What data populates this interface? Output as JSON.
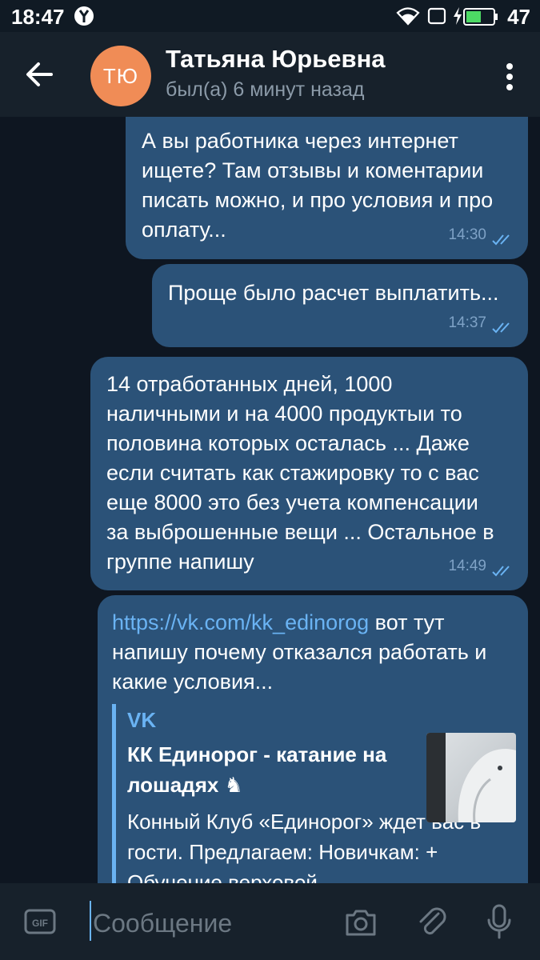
{
  "status_bar": {
    "time": "18:47",
    "battery_percent": "47"
  },
  "header": {
    "avatar_initials": "ТЮ",
    "name": "Татьяна Юрьевна",
    "status": "был(а) 6 минут назад"
  },
  "messages": [
    {
      "text": "А вы работника через интернет\nищете? Там отзывы и коментарии\nписать можно, и про условия и про\nоплату...",
      "time": "14:30"
    },
    {
      "text": "Проще было расчет выплатить...",
      "time": "14:37"
    },
    {
      "text": "14 отработанных дней, 1000\nналичными и на 4000 продуктыи то\nполовина которых осталась ... Даже\nесли считать как стажировку то с вас\nеще 8000 это без учета компенсации\nза выброшенные вещи ... Остальное в\nгруппе напишу",
      "time": "14:49"
    },
    {
      "link": "https://vk.com/kk_edinorog",
      "text": " вот тут\nнапишу почему отказался работать и\nкакие условия...",
      "preview": {
        "site": "VK",
        "title": "КК Единорог - катание на лошадях ♞",
        "description": "Конный Клуб «Единорог» ждет вас в гости.  Предлагаем: Новичкам: + Обучение верховой"
      }
    }
  ],
  "input": {
    "placeholder": "Сообщение"
  },
  "colors": {
    "background": "#0e1621",
    "header": "#17212b",
    "bubble_out": "#2b5278",
    "accent": "#6ab3f3",
    "avatar": "#f08c56"
  },
  "icons": {
    "back": "back-arrow-icon",
    "menu": "more-vertical-icon",
    "checks": "double-check-icon",
    "scroll": "arrow-down-icon",
    "gif": "gif-icon",
    "camera": "camera-icon",
    "attach": "paperclip-icon",
    "mic": "microphone-icon"
  }
}
